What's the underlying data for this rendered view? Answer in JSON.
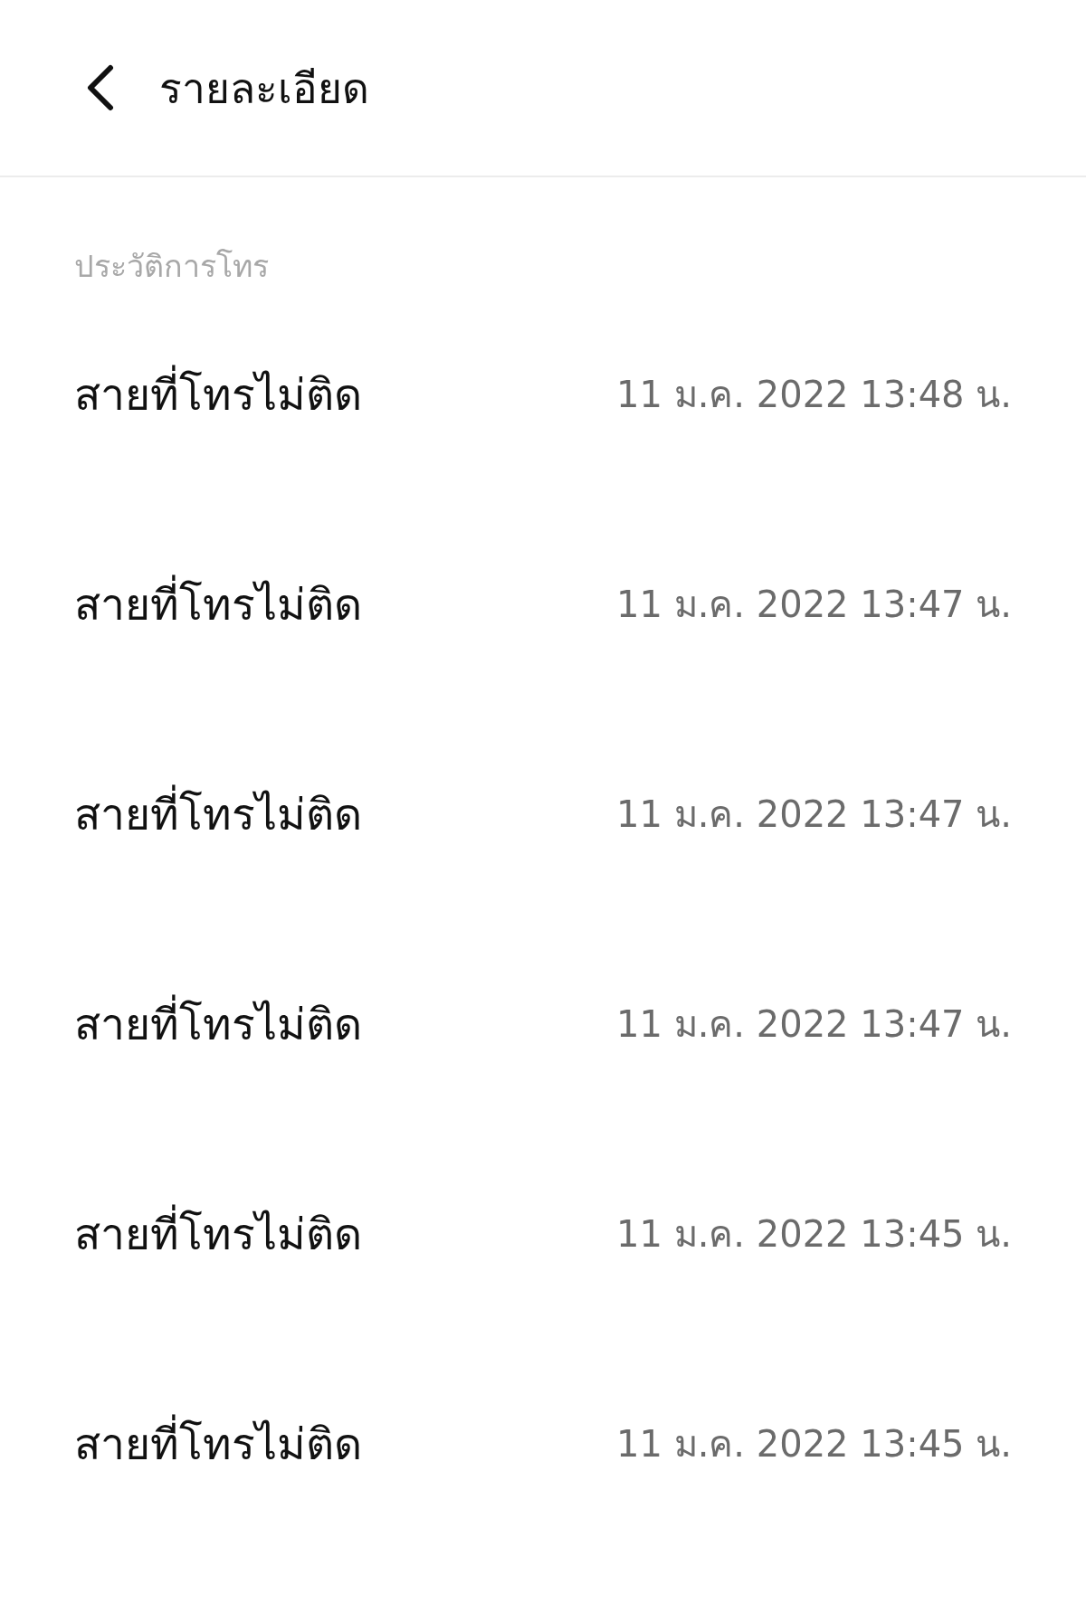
{
  "header": {
    "title": "รายละเอียด"
  },
  "call_history": {
    "heading": "ประวัติการโทร",
    "rows": [
      {
        "label": "สายที่โทรไม่ติด",
        "time": "11 ม.ค. 2022 13:48 น."
      },
      {
        "label": "สายที่โทรไม่ติด",
        "time": "11 ม.ค. 2022 13:47 น."
      },
      {
        "label": "สายที่โทรไม่ติด",
        "time": "11 ม.ค. 2022 13:47 น."
      },
      {
        "label": "สายที่โทรไม่ติด",
        "time": "11 ม.ค. 2022 13:47 น."
      },
      {
        "label": "สายที่โทรไม่ติด",
        "time": "11 ม.ค. 2022 13:45 น."
      },
      {
        "label": "สายที่โทรไม่ติด",
        "time": "11 ม.ค. 2022 13:45 น."
      }
    ]
  }
}
